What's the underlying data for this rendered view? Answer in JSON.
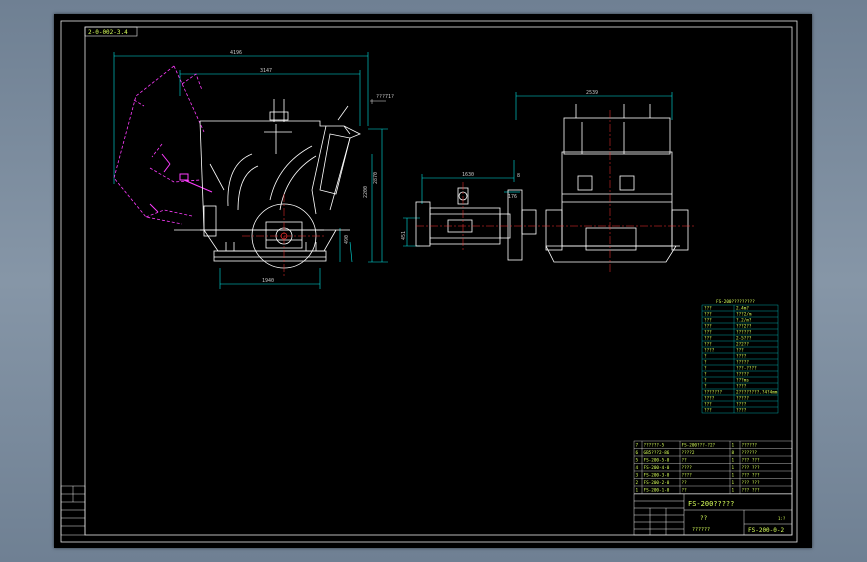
{
  "drawing_code": "2-0-002-3.4",
  "front_view": {
    "dim_top_outer": "4196",
    "dim_top_inner": "3147",
    "dim_height_total": "2870",
    "dim_height_mid": "2200",
    "dim_height_low": "490",
    "dim_base_width": "1940",
    "label_top_right": "???71?"
  },
  "side_view": {
    "dim_top": "2539",
    "dim_motor_width": "1630",
    "dim_small_a": "176",
    "dim_small_b": "8",
    "dim_height": "451"
  },
  "specs_table": {
    "title": "FS-200?????????",
    "rows": [
      [
        "???",
        "2.4m?"
      ],
      [
        "???",
        "???2/m"
      ],
      [
        "???",
        "?.2/m?"
      ],
      [
        "???",
        "???2??"
      ],
      [
        "???",
        "??????"
      ],
      [
        "???",
        "2-5???"
      ],
      [
        "???",
        "2?2??"
      ],
      [
        "????",
        "???"
      ],
      [
        "?",
        "????"
      ],
      [
        "?",
        "?????"
      ],
      [
        "?",
        "???-????"
      ],
      [
        "?",
        "?????"
      ],
      [
        "?",
        "???ms"
      ],
      [
        "?",
        "????"
      ],
      [
        "???????",
        "2????????.?4?4mm"
      ],
      [
        "????",
        "?????"
      ],
      [
        "???",
        "????"
      ],
      [
        "???",
        "????"
      ]
    ]
  },
  "parts_list": {
    "rows": [
      [
        "7",
        "??????-5",
        "FS-200???-?2?",
        "1",
        "??????"
      ],
      [
        "6",
        "GB5???2-86",
        "????2",
        "8",
        "??????"
      ],
      [
        "5",
        "FS-200-5-0",
        "??",
        "1",
        "??? ???"
      ],
      [
        "4",
        "FS-200-4-0",
        "????",
        "1",
        "??? ???"
      ],
      [
        "3",
        "FS-200-3-0",
        "????",
        "1",
        "??? ???"
      ],
      [
        "2",
        "FS-200-2-0",
        "??",
        "1",
        "??? ???"
      ],
      [
        "1",
        "FS-200-1-0",
        "??",
        "1",
        "??? ???"
      ]
    ]
  },
  "title_block": {
    "name": "FS-200?????",
    "sub1": "??",
    "sub2": "??????",
    "drawing_no": "FS-200-0-2",
    "scale_note": "1:?"
  },
  "colors": {
    "border": "#e8e8e8",
    "outline": "#ffffff",
    "dimension": "#00e5e5",
    "centerline": "#ff3030",
    "hidden": "#ff3cff",
    "text": "#d7ff5a",
    "grid": "#00c8c8"
  }
}
